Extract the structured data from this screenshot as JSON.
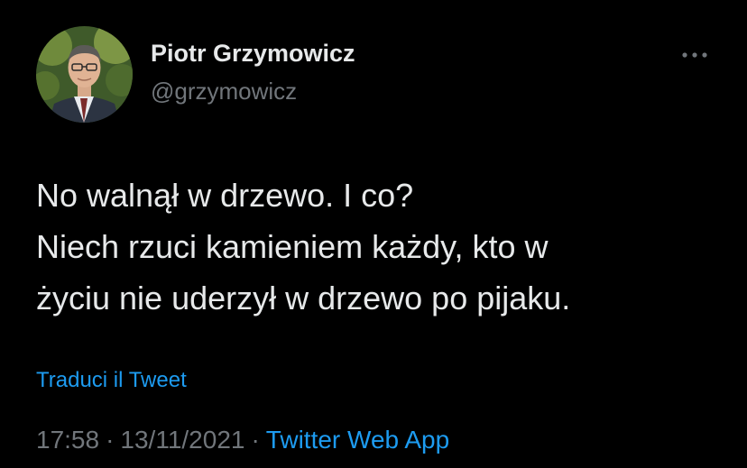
{
  "author": {
    "name": "Piotr Grzymowicz",
    "handle": "@grzymowicz"
  },
  "tweet": {
    "lines": [
      "No walnął w drzewo. I co?",
      "Niech rzuci kamieniem każdy, kto w",
      "życiu nie uderzył w drzewo po pijaku."
    ],
    "translate_label": "Traduci il Tweet"
  },
  "meta": {
    "time": "17:58",
    "separator": "·",
    "date": "13/11/2021",
    "source": "Twitter Web App"
  },
  "icons": {
    "more": "more-horizontal-icon",
    "avatar": "profile-photo"
  },
  "colors": {
    "background": "#000000",
    "text_primary": "#e7e9ea",
    "text_secondary": "#71767b",
    "link": "#1d9bf0"
  }
}
